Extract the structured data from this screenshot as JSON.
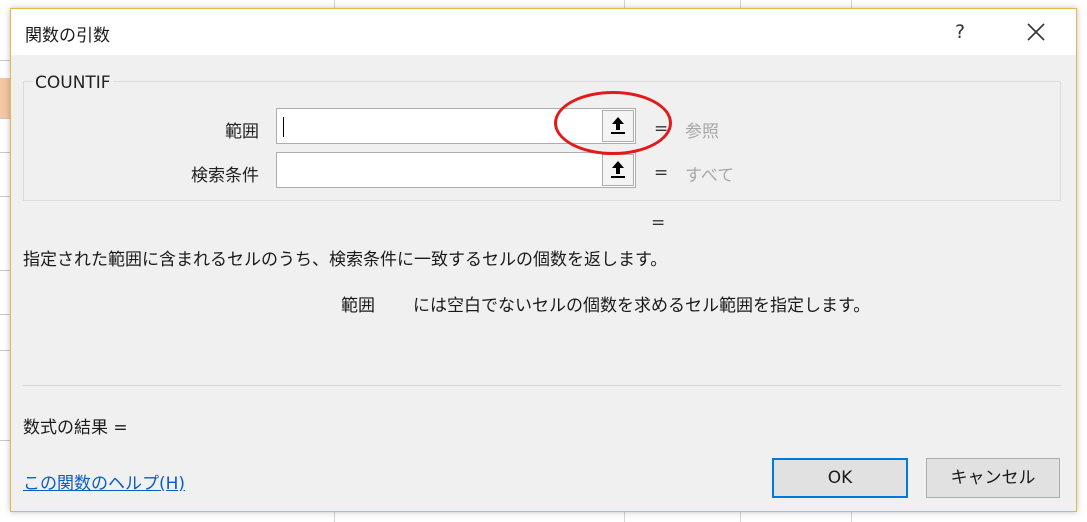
{
  "dialog": {
    "title": "関数の引数",
    "help_label": "?",
    "close_label": "✕"
  },
  "function": {
    "name": "COUNTIF",
    "args": [
      {
        "label": "範囲",
        "value": "",
        "hint": "参照"
      },
      {
        "label": "検索条件",
        "value": "",
        "hint": "すべて"
      }
    ],
    "eq_sign": "=",
    "result_eq": "=",
    "description": "指定された範囲に含まれるセルのうち、検索条件に一致するセルの個数を返します。",
    "arg_desc_name": "範囲",
    "arg_desc_text": "には空白でないセルの個数を求めるセル範囲を指定します。"
  },
  "footer": {
    "formula_result": "数式の結果 =",
    "help_link": "この関数のヘルプ(H)",
    "ok_label": "OK",
    "cancel_label": "キャンセル"
  },
  "colors": {
    "highlight": "#e21a1a",
    "link": "#0b5cc4",
    "ok_border": "#0078d7"
  },
  "icons": {
    "ref_button": "collapse-dialog-arrow-icon"
  }
}
